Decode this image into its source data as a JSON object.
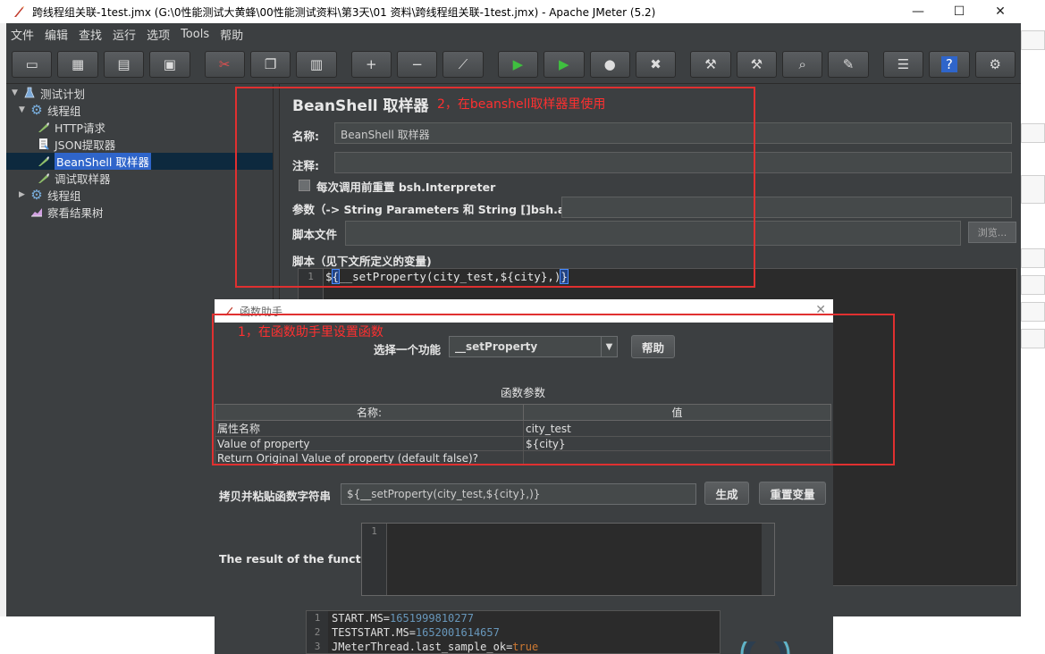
{
  "window": {
    "title": "跨线程组关联-1test.jmx (G:\\0性能测试大黄蜂\\00性能测试资料\\第3天\\01 资料\\跨线程组关联-1test.jmx) - Apache JMeter (5.2)",
    "minimize": "—",
    "maximize": "☐",
    "close": "✕"
  },
  "menu": [
    "文件",
    "编辑",
    "查找",
    "运行",
    "选项",
    "Tools",
    "帮助"
  ],
  "toolbar": [
    {
      "name": "new-icon",
      "glyph": "▭"
    },
    {
      "name": "templates-icon",
      "glyph": "▦"
    },
    {
      "name": "open-icon",
      "glyph": "▤"
    },
    {
      "name": "save-icon",
      "glyph": "▣"
    },
    {
      "name": "cut-icon",
      "glyph": "✂"
    },
    {
      "name": "copy-icon",
      "glyph": "❐"
    },
    {
      "name": "paste-icon",
      "glyph": "▥"
    },
    {
      "name": "expand-icon",
      "glyph": "+"
    },
    {
      "name": "collapse-icon",
      "glyph": "−"
    },
    {
      "name": "toggle-icon",
      "glyph": "⟋"
    },
    {
      "name": "start-icon",
      "glyph": "▶"
    },
    {
      "name": "start-no-pause-icon",
      "glyph": "▶"
    },
    {
      "name": "stop-icon",
      "glyph": "●"
    },
    {
      "name": "shutdown-icon",
      "glyph": "✖"
    },
    {
      "name": "clear-icon",
      "glyph": "⚒"
    },
    {
      "name": "clear-all-icon",
      "glyph": "⚒"
    },
    {
      "name": "search-icon",
      "glyph": "⌕"
    },
    {
      "name": "reset-search-icon",
      "glyph": "✎"
    },
    {
      "name": "function-helper-icon",
      "glyph": "☰"
    },
    {
      "name": "help-icon",
      "glyph": "?"
    },
    {
      "name": "remote-icon",
      "glyph": "⚙"
    }
  ],
  "tree": {
    "items": [
      {
        "label": "测试计划",
        "icon": "flask-icon",
        "arrow": "▼"
      },
      {
        "label": "线程组",
        "icon": "gear-icon",
        "arrow": "▼"
      },
      {
        "label": "HTTP请求",
        "icon": "pipette-icon",
        "arrow": ""
      },
      {
        "label": "JSON提取器",
        "icon": "document-icon",
        "arrow": ""
      },
      {
        "label": "BeanShell 取样器",
        "icon": "pipette-icon",
        "arrow": ""
      },
      {
        "label": "调试取样器",
        "icon": "pipette-icon",
        "arrow": ""
      },
      {
        "label": "线程组",
        "icon": "gear-icon",
        "arrow": "▶"
      },
      {
        "label": "察看结果树",
        "icon": "chart-icon",
        "arrow": ""
      }
    ]
  },
  "editor": {
    "title": "BeanShell 取样器",
    "name_label": "名称:",
    "name_value": "BeanShell 取样器",
    "comment_label": "注释:",
    "comment_value": "",
    "reset_label": "每次调用前重置 bsh.Interpreter",
    "params_label": "参数（-> String Parameters 和 String []bsh.args)",
    "params_value": "",
    "script_file_label": "脚本文件",
    "browse": "浏览...",
    "script_label": "脚本（见下文所定义的变量)",
    "script_line": "1",
    "script_prefix": "$",
    "script_open": "{",
    "script_body": "__setProperty(city_test,${city},)",
    "script_close": "}"
  },
  "annotations": {
    "top": "2，在beanshell取样器里使用",
    "bottom": "1，在函数助手里设置函数"
  },
  "dialog": {
    "title": "函数助手",
    "close": "✕",
    "choose_label": "选择一个功能",
    "function_value": "__setProperty",
    "help_button": "帮助",
    "params_title": "函数参数",
    "col_name": "名称:",
    "col_value": "值",
    "rows": [
      {
        "name": "属性名称",
        "value": "city_test"
      },
      {
        "name": "Value of property",
        "value": "${city}"
      },
      {
        "name": "Return Original Value of property (default false)?",
        "value": ""
      }
    ],
    "copy_label": "拷贝并粘贴函数字符串",
    "copy_value": "${__setProperty(city_test,${city},)}",
    "generate_button": "生成",
    "reset_button": "重置变量",
    "result_label": "The result of the function is",
    "result_line": "1"
  },
  "log": {
    "lines": [
      {
        "n": "1",
        "key": "START.MS=",
        "val": "1651999810277"
      },
      {
        "n": "2",
        "key": "TESTSTART.MS=",
        "val": "1652001614657"
      },
      {
        "n": "3",
        "key": "JMeterThread.last_sample_ok=",
        "val": "true"
      }
    ]
  }
}
